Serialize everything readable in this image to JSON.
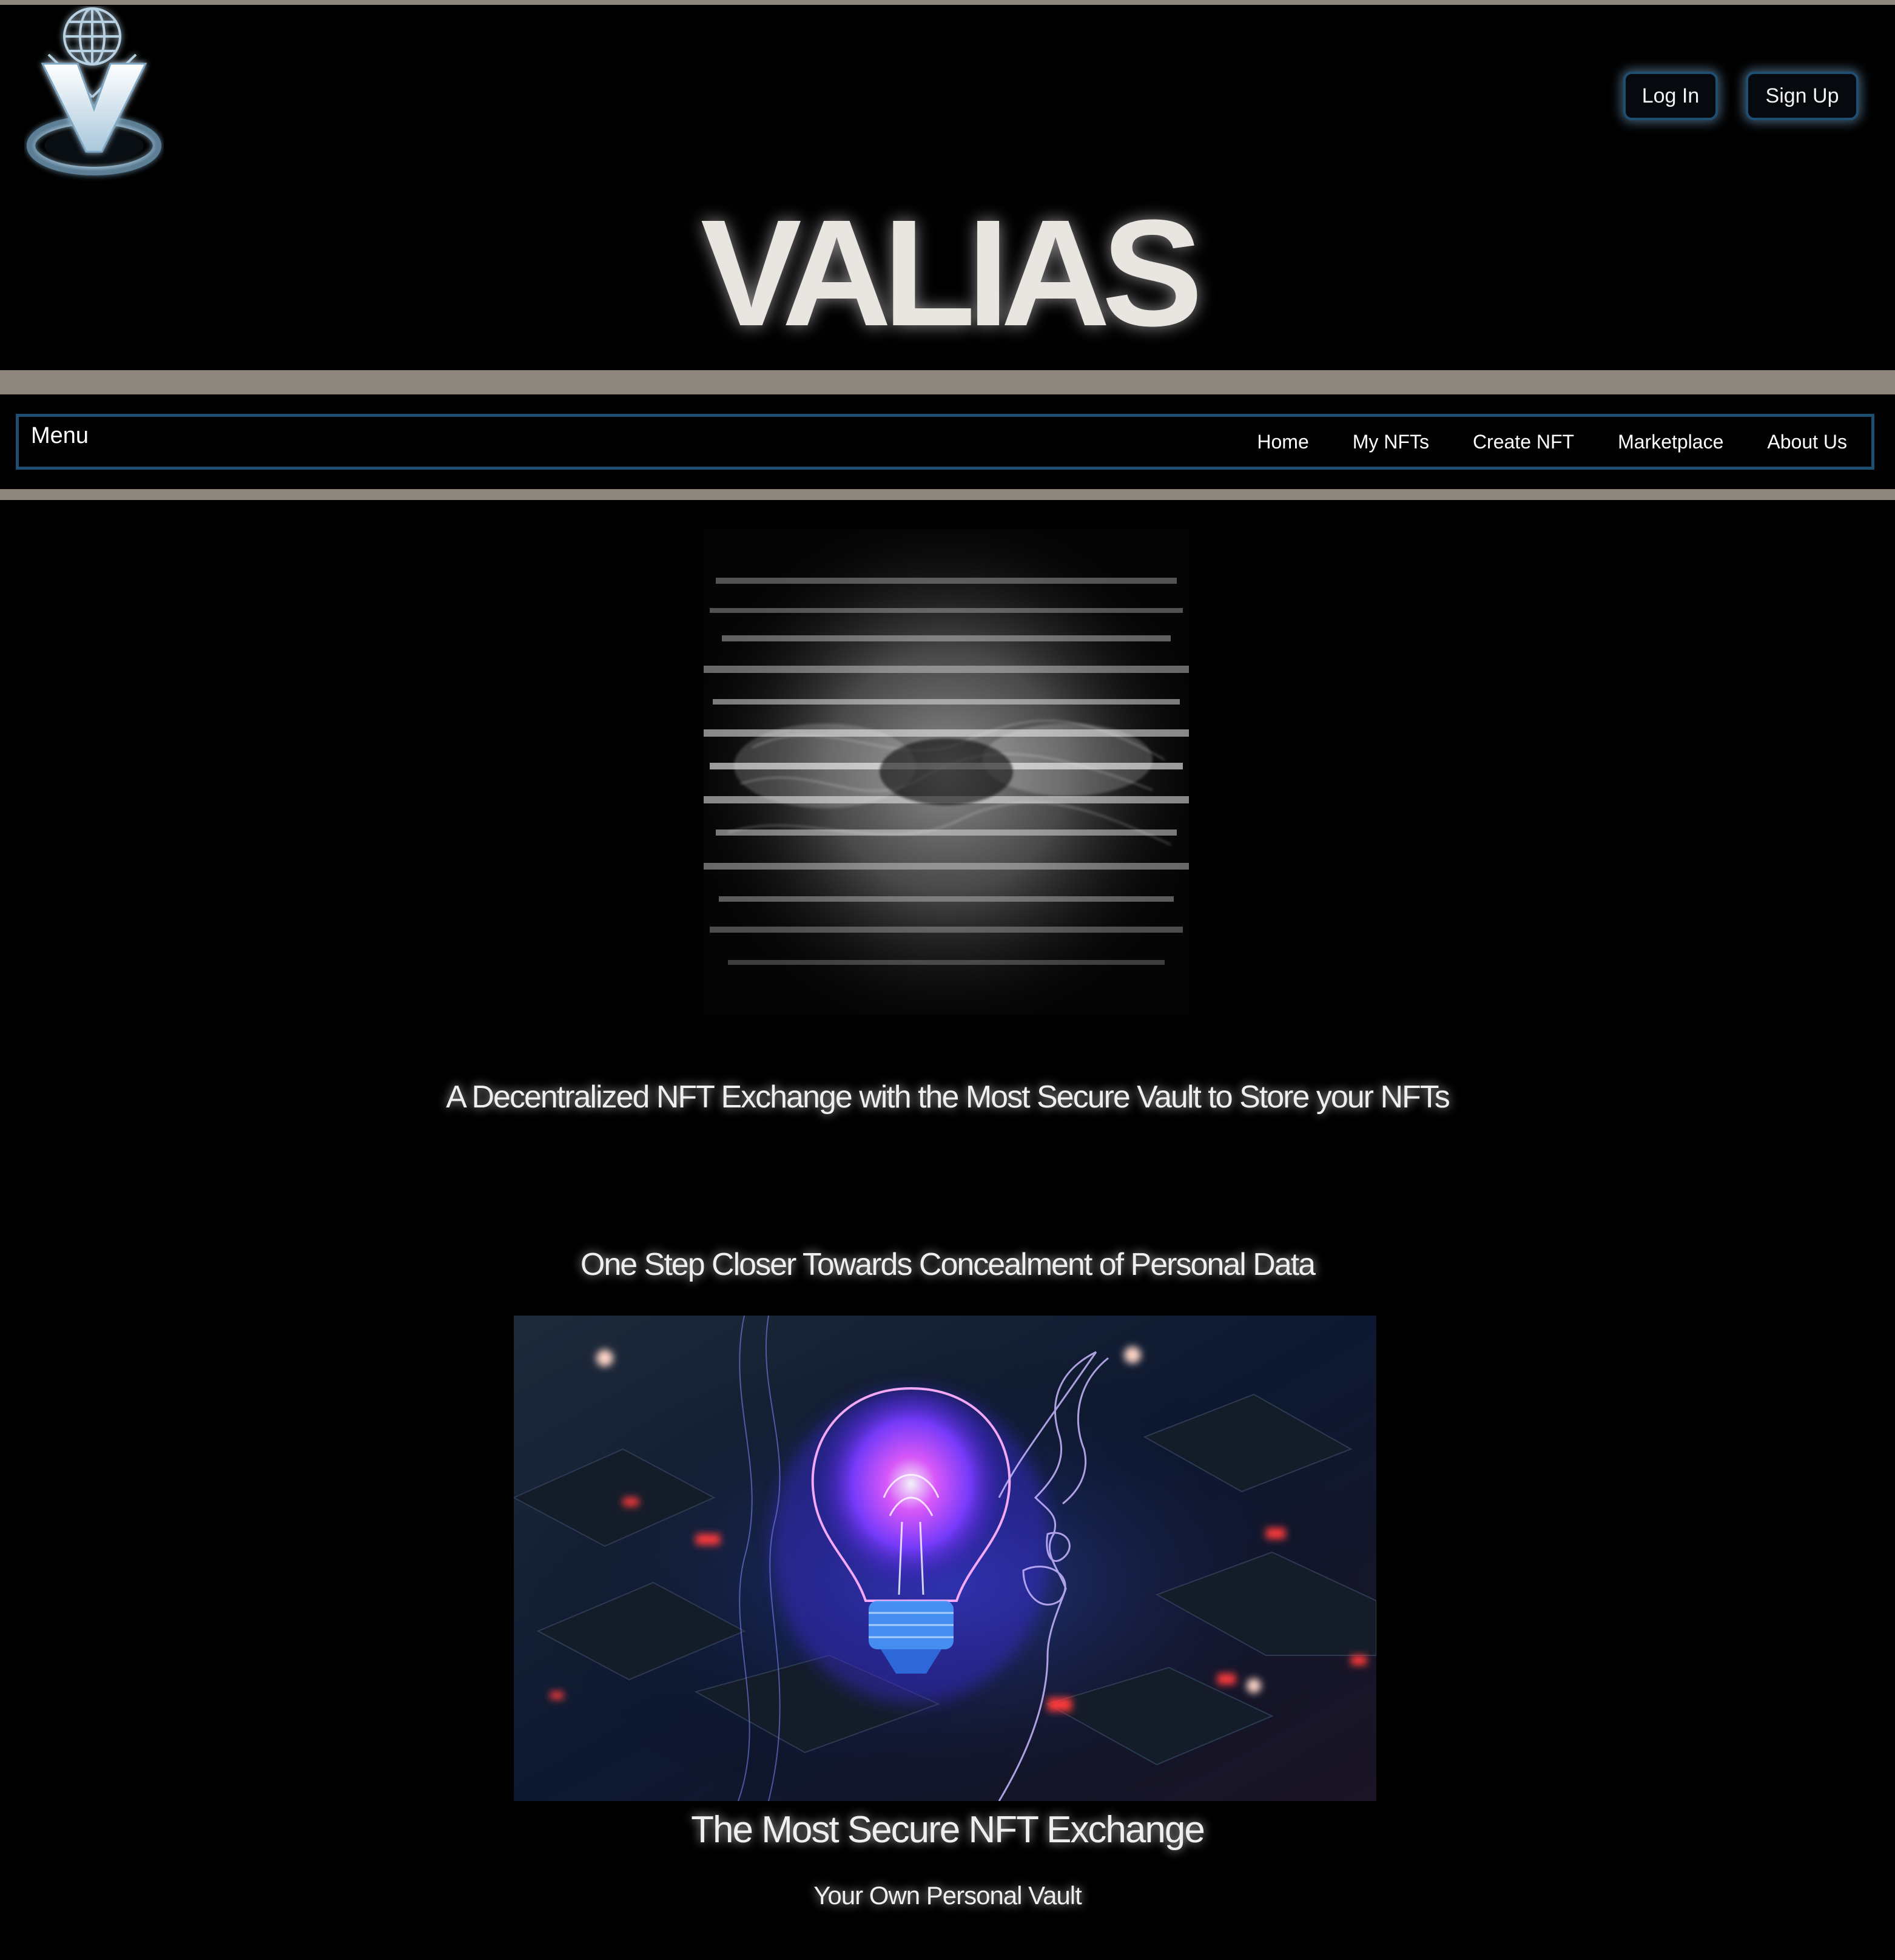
{
  "brand": {
    "title": "VALIAS",
    "logo_icon": "globe-v-vault-logo-icon"
  },
  "auth": {
    "login_label": "Log In",
    "signup_label": "Sign Up"
  },
  "nav": {
    "menu_label": "Menu",
    "items": [
      "Home",
      "My NFTs",
      "Create NFT",
      "Marketplace",
      "About Us"
    ]
  },
  "hero": {
    "image_icon": "nft-word-cloud-image",
    "tagline": "A Decentralized NFT Exchange with the Most Secure Vault to Store your NFTs"
  },
  "feature": {
    "heading": "One Step Closer Towards Concealment of Personal Data",
    "image_icon": "lightbulb-face-image",
    "title": "The Most Secure NFT Exchange",
    "subtitle": "Your Own Personal Vault"
  },
  "colors": {
    "background": "#000000",
    "stripe": "#8c867c",
    "nav_border": "#1f4e73",
    "title": "#e9e6e1"
  }
}
